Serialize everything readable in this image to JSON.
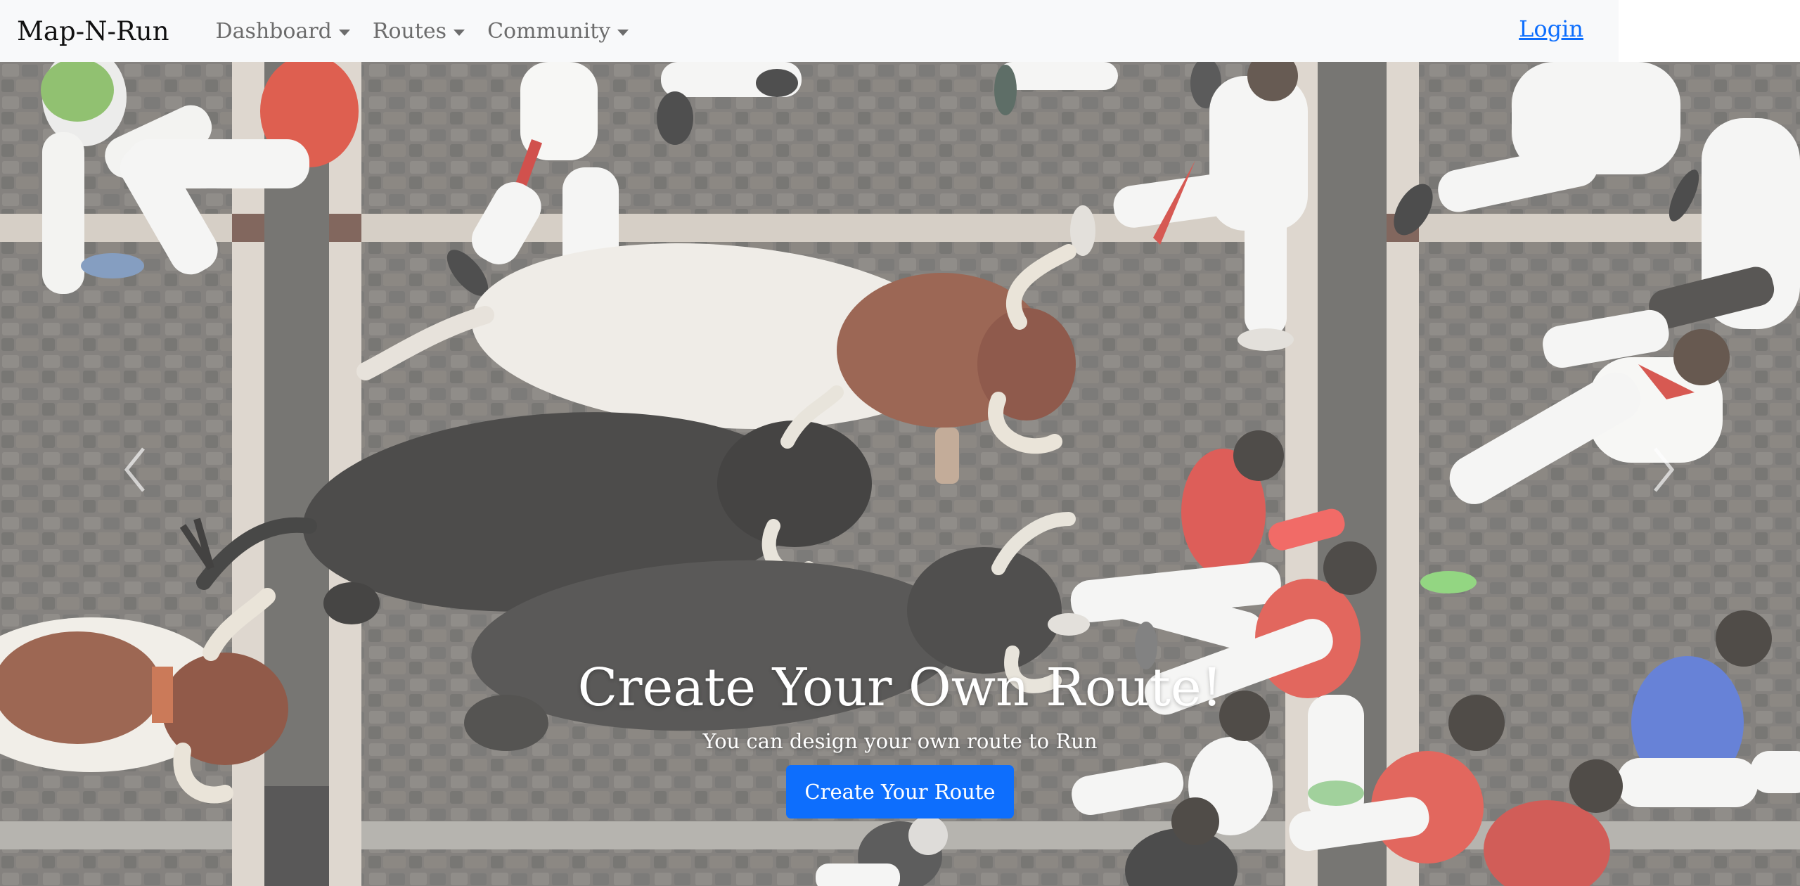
{
  "navbar": {
    "brand": "Map-N-Run",
    "items": [
      {
        "label": "Dashboard"
      },
      {
        "label": "Routes"
      },
      {
        "label": "Community"
      }
    ],
    "login": "Login"
  },
  "hero": {
    "title": "Create Your Own Route!",
    "subtitle": "You can design your own route to Run",
    "button": "Create Your Route"
  },
  "colors": {
    "primary": "#0d6efd",
    "navbar_bg": "#f8f9fa",
    "nav_text": "#6c6c6c"
  },
  "icons": {
    "prev": "chevron-left-icon",
    "next": "chevron-right-icon",
    "dropdown": "caret-down-icon"
  }
}
